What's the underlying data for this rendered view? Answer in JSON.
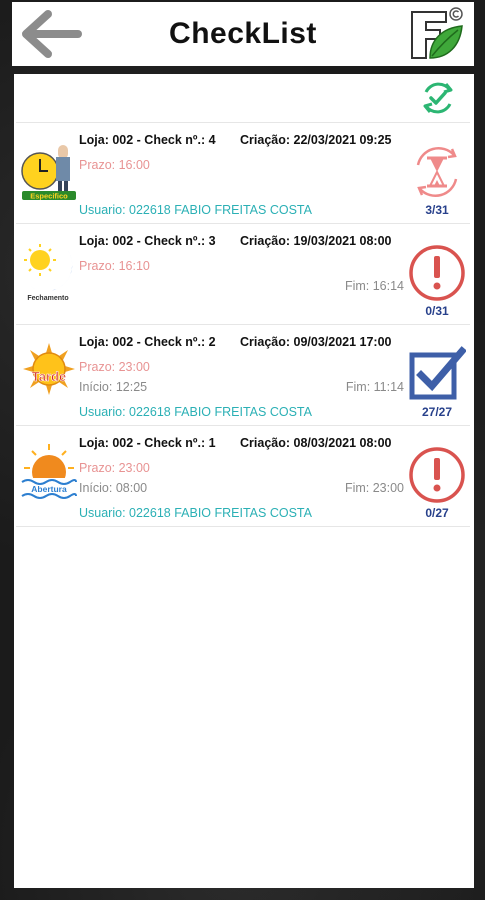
{
  "header": {
    "title": "CheckList"
  },
  "colors": {
    "pending_red": "#d9534f",
    "in_progress_pink": "#ef8a8a",
    "done_blue": "#3e5fa8",
    "sync_green": "#2cb673",
    "user_teal": "#2bb0b5",
    "deadline_pink": "#e89393"
  },
  "checklists": [
    {
      "loja": "Loja: 002 - Check nº.: 4",
      "criacao": "Criação: 22/03/2021 09:25",
      "prazo": "Prazo: 16:00",
      "inicio": "",
      "fim": "",
      "usuario": "Usuario: 022618 FABIO FREITAS COSTA",
      "icon_label": "Especifico",
      "status_icon": "hourglass-icon",
      "progress": "3/31"
    },
    {
      "loja": "Loja: 002 - Check nº.: 3",
      "criacao": "Criação: 19/03/2021 08:00",
      "prazo": "Prazo: 16:10",
      "inicio": "",
      "fim": "Fim: 16:14",
      "usuario": "",
      "icon_label": "Fechamento",
      "status_icon": "alert-icon",
      "progress": "0/31"
    },
    {
      "loja": "Loja: 002 - Check nº.: 2",
      "criacao": "Criação: 09/03/2021 17:00",
      "prazo": "Prazo: 23:00",
      "inicio": "Início: 12:25",
      "fim": "Fim: 11:14",
      "usuario": "Usuario: 022618 FABIO FREITAS COSTA",
      "icon_label": "Tarde",
      "status_icon": "checked-box-icon",
      "progress": "27/27"
    },
    {
      "loja": "Loja: 002 - Check nº.: 1",
      "criacao": "Criação: 08/03/2021 08:00",
      "prazo": "Prazo: 23:00",
      "inicio": "Início: 08:00",
      "fim": "Fim: 23:00",
      "usuario": "Usuario: 022618 FABIO FREITAS COSTA",
      "icon_label": "Abertura",
      "status_icon": "alert-icon",
      "progress": "0/27"
    }
  ]
}
